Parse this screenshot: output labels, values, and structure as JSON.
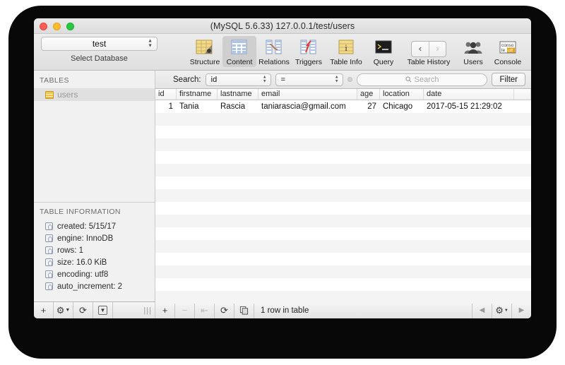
{
  "window": {
    "title": "(MySQL 5.6.33) 127.0.0.1/test/users",
    "traffic": {
      "close": "close-button",
      "minimize": "minimize-button",
      "zoom": "zoom-button"
    }
  },
  "toolbar": {
    "database": {
      "value": "test",
      "caption": "Select Database"
    },
    "tabs": [
      {
        "label": "Structure",
        "icon": "structure-icon",
        "selected": false
      },
      {
        "label": "Content",
        "icon": "content-icon",
        "selected": true
      },
      {
        "label": "Relations",
        "icon": "relations-icon",
        "selected": false
      },
      {
        "label": "Triggers",
        "icon": "triggers-icon",
        "selected": false
      },
      {
        "label": "Table Info",
        "icon": "table-info-icon",
        "selected": false
      },
      {
        "label": "Query",
        "icon": "query-icon",
        "selected": false
      }
    ],
    "history": {
      "label": "Table History",
      "back": "‹",
      "forward": "›"
    },
    "users": {
      "label": "Users",
      "icon": "users-icon"
    },
    "console": {
      "label": "Console",
      "icon": "console-icon",
      "line1": "conso",
      "line2": "le off"
    }
  },
  "sidebar": {
    "tables_header": "TABLES",
    "tables": [
      {
        "name": "users",
        "selected": true
      }
    ],
    "info_header": "TABLE INFORMATION",
    "info": [
      {
        "label": "created: 5/15/17"
      },
      {
        "label": "engine: InnoDB"
      },
      {
        "label": "rows: 1"
      },
      {
        "label": "size: 16.0 KiB"
      },
      {
        "label": "encoding: utf8"
      },
      {
        "label": "auto_increment: 2"
      }
    ]
  },
  "search": {
    "label": "Search:",
    "field_value": "id",
    "operator_value": "=",
    "placeholder": "Search",
    "value": "",
    "filter_label": "Filter"
  },
  "table": {
    "columns": [
      "id",
      "firstname",
      "lastname",
      "email",
      "age",
      "location",
      "date"
    ],
    "rows": [
      {
        "id": "1",
        "firstname": "Tania",
        "lastname": "Rascia",
        "email": "taniarascia@gmail.com",
        "age": "27",
        "location": "Chicago",
        "date": "2017-05-15 21:29:02"
      }
    ],
    "empty_row_count": 15
  },
  "statusbar": {
    "left_buttons": [
      {
        "icon": "add-table-button",
        "glyph": "+"
      },
      {
        "icon": "table-actions-gear-button",
        "glyph": "⚙"
      },
      {
        "icon": "refresh-tables-button",
        "glyph": "⟳"
      },
      {
        "icon": "filter-tables-button",
        "glyph": "▼"
      }
    ],
    "resize_grip": "|||",
    "row_buttons": [
      {
        "icon": "add-row-button",
        "glyph": "+",
        "enabled": true
      },
      {
        "icon": "delete-row-button",
        "glyph": "−",
        "enabled": false
      },
      {
        "icon": "duplicate-row-button",
        "glyph": "⇤",
        "enabled": false
      },
      {
        "icon": "refresh-rows-button",
        "glyph": "⟳",
        "enabled": true
      },
      {
        "icon": "copy-rows-button",
        "glyph": "❐",
        "enabled": true
      }
    ],
    "status_text": "1 row in table",
    "pager": [
      {
        "icon": "previous-page-button",
        "glyph": "◀"
      },
      {
        "icon": "row-options-gear-button",
        "glyph": "⚙"
      },
      {
        "icon": "next-page-button",
        "glyph": "▶"
      }
    ]
  },
  "colors": {
    "accent_selected": "#cfcfcf",
    "table_icon": "#f0bb2a",
    "stripe": "#f4f4f4"
  }
}
